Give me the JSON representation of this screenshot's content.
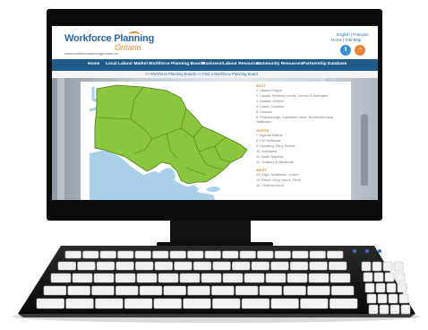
{
  "site": {
    "logo_line1": "Workforce Planning",
    "logo_line2": "Ontario",
    "logo_url": "www.workforceplanningontario.ca",
    "lang_links": "English | Français",
    "util_links": "Home | Site Map",
    "twitter_glyph": "t",
    "rss_glyph": "◔"
  },
  "nav": {
    "items": [
      "Home",
      "Local Labour Market",
      "Workforce Planning Boards",
      "Business/Labour Resources",
      "Community Resources",
      "Partnership Database"
    ]
  },
  "breadcrumb": ">> Workforce Planning Boards >> Find a Workforce Planning Board",
  "board_list": {
    "regions": [
      {
        "name": "EAST",
        "boards": [
          "1. Ottawa Region",
          "2. Lanark, Renfrew, Leeds, Lennox & Addington",
          "3. Eastern Ontario",
          "4. Lakes, Counties",
          "5. Durham",
          "6. Peterborough, Kawartha Lakes, Northumberland, Haliburton"
        ]
      },
      {
        "name": "NORTH",
        "boards": [
          "7. Algoma District",
          "8. Far Northeast",
          "9. Nipissing, Parry Sound",
          "10. Northwest",
          "11. North Superior",
          "12. Sudbury & Manitoulin"
        ]
      },
      {
        "name": "WEST",
        "boards": [
          "13. Elgin, Middlesex, Oxford",
          "14. Bruce, Grey, Huron, Perth",
          "15. Chatham-Kent"
        ]
      }
    ]
  },
  "colors": {
    "map_green": "#8cc63f",
    "water_blue": "#a9cfe9",
    "nav_blue": "#1e5a8a",
    "accent_orange": "#e38b2c"
  }
}
